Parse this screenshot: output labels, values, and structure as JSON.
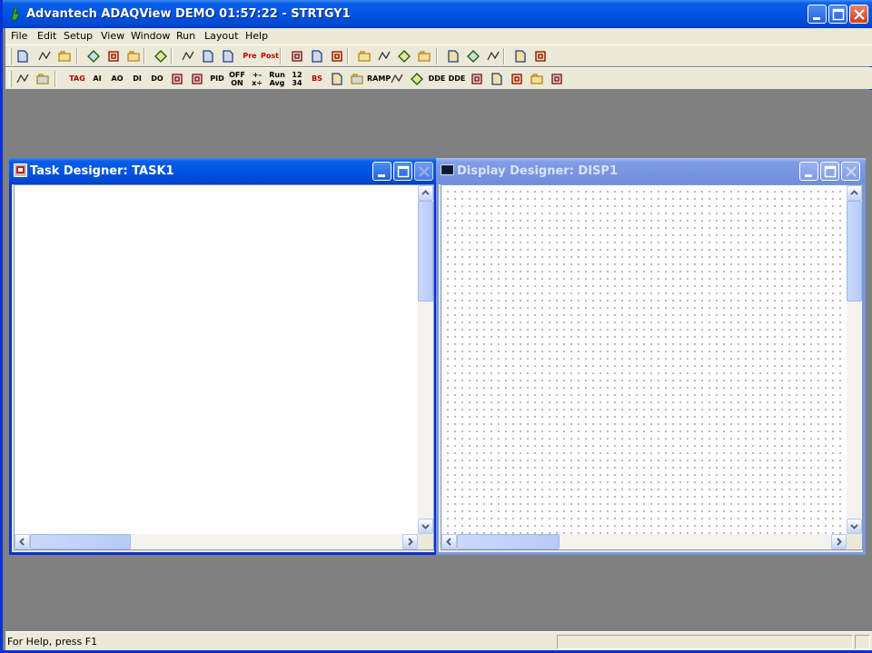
{
  "app": {
    "title": "Advantech ADAQView DEMO 01:57:22 - STRTGY1"
  },
  "caption_buttons": [
    "minimize",
    "maximize",
    "close"
  ],
  "menu": [
    "File",
    "Edit",
    "Setup",
    "View",
    "Window",
    "Run",
    "Layout",
    "Help"
  ],
  "toolbar1": [
    {
      "name": "new-icon"
    },
    {
      "name": "open-icon"
    },
    {
      "name": "save-icon"
    },
    {
      "name": "cut-icon"
    },
    {
      "name": "copy-icon"
    },
    {
      "name": "paste-icon"
    },
    {
      "name": "add-task-icon"
    },
    {
      "name": "task-up-icon"
    },
    {
      "name": "task-down-icon"
    },
    {
      "name": "task-config-icon"
    },
    {
      "name": "pre-task-icon",
      "label": "Pre"
    },
    {
      "name": "post-task-icon",
      "label": "Post"
    },
    {
      "name": "display-icon"
    },
    {
      "name": "display-add-icon"
    },
    {
      "name": "display-config-icon"
    },
    {
      "name": "run-icon"
    },
    {
      "name": "step-icon"
    },
    {
      "name": "forward-icon"
    },
    {
      "name": "backward-icon"
    },
    {
      "name": "lock-icon"
    },
    {
      "name": "unlock-icon"
    },
    {
      "name": "protect-icon"
    },
    {
      "name": "help-icon"
    },
    {
      "name": "context-help-icon"
    }
  ],
  "toolbar2": [
    {
      "name": "pointer-icon"
    },
    {
      "name": "connect-icon"
    },
    {
      "name": "tag-icon",
      "label": "TAG"
    },
    {
      "name": "analog-in-icon",
      "label": "AI"
    },
    {
      "name": "analog-out-icon",
      "label": "AO"
    },
    {
      "name": "digital-in-icon",
      "label": "DI"
    },
    {
      "name": "digital-out-icon",
      "label": "DO"
    },
    {
      "name": "temperature-icon"
    },
    {
      "name": "counter-icon"
    },
    {
      "name": "pid-icon",
      "label": "PID"
    },
    {
      "name": "on-off-icon",
      "label": "OFF ON"
    },
    {
      "name": "math-icon",
      "label": "+- x÷"
    },
    {
      "name": "running-avg-icon",
      "label": "Run Avg"
    },
    {
      "name": "number-icon",
      "label": "12 34"
    },
    {
      "name": "bs-icon",
      "label": "BS"
    },
    {
      "name": "timer-icon"
    },
    {
      "name": "event-icon"
    },
    {
      "name": "ramp-icon",
      "label": "RAMP"
    },
    {
      "name": "export-icon"
    },
    {
      "name": "import-icon"
    },
    {
      "name": "dde-out-icon",
      "label": "DDE"
    },
    {
      "name": "dde-in-icon",
      "label": "DDE"
    },
    {
      "name": "network-icon"
    },
    {
      "name": "alarm-icon"
    },
    {
      "name": "sound-icon"
    },
    {
      "name": "script-icon"
    },
    {
      "name": "web-icon"
    }
  ],
  "task_window": {
    "title": "Task Designer:  TASK1"
  },
  "display_window": {
    "title": "Display Designer:  DISP1"
  },
  "status": {
    "text": "For Help, press F1"
  },
  "colors": {
    "titlebar_active": "#0054e3",
    "titlebar_inactive": "#7a96df",
    "face": "#ece9d8",
    "mdi_background": "#808080"
  }
}
